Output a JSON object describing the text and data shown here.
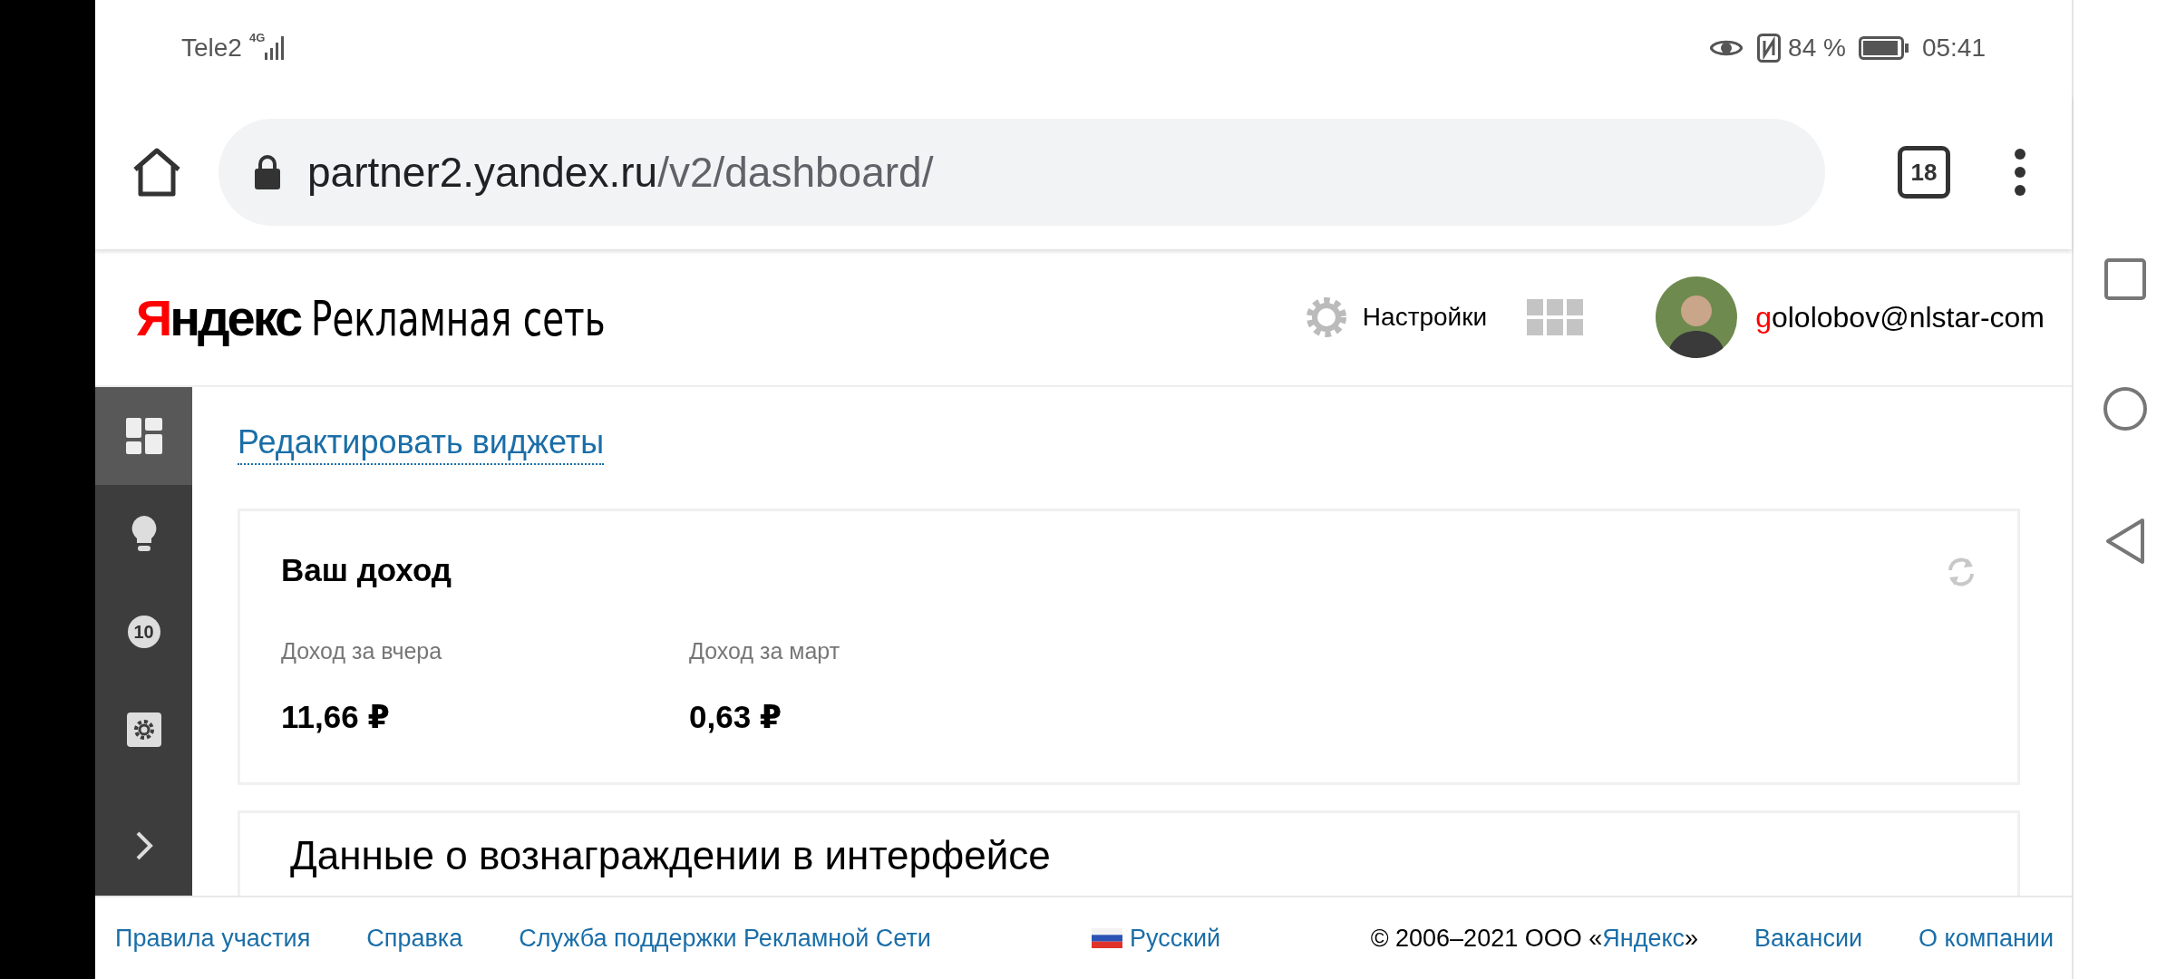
{
  "status_bar": {
    "carrier": "Tele2",
    "network": "4G",
    "battery": "84 %",
    "time": "05:41"
  },
  "browser": {
    "url_host": "partner2.yandex.ru",
    "url_path": "/v2/dashboard/",
    "tab_count": "18"
  },
  "header": {
    "logo": {
      "accent": "Я",
      "rest": "ндекс",
      "product": "Рекламная сеть"
    },
    "settings_label": "Настройки",
    "user": {
      "accent": "g",
      "rest": "ololobov@nlstar-com"
    }
  },
  "sidebar": {
    "items": [
      {
        "kind": "dashboard",
        "selected": true
      },
      {
        "kind": "bulb",
        "selected": false
      },
      {
        "kind": "badge",
        "text": "10",
        "selected": false
      },
      {
        "kind": "settings",
        "selected": false
      },
      {
        "kind": "expand",
        "selected": false
      }
    ]
  },
  "edit_link": "Редактировать виджеты",
  "income_card": {
    "title": "Ваш доход",
    "metrics": [
      {
        "label": "Доход за вчера",
        "value": "11,66 ₽"
      },
      {
        "label": "Доход за март",
        "value": "0,63 ₽"
      }
    ]
  },
  "next_card": {
    "title": "Данные о вознаграждении в интерфейсе"
  },
  "footer": {
    "links": [
      "Правила участия",
      "Справка",
      "Служба поддержки Рекламной Сети"
    ],
    "language": "Русский",
    "copyright": {
      "before": "© 2006–2021 ООО «",
      "link": "Яндекс",
      "after": "»"
    },
    "right_links": [
      "Вакансии",
      "О компании"
    ]
  }
}
